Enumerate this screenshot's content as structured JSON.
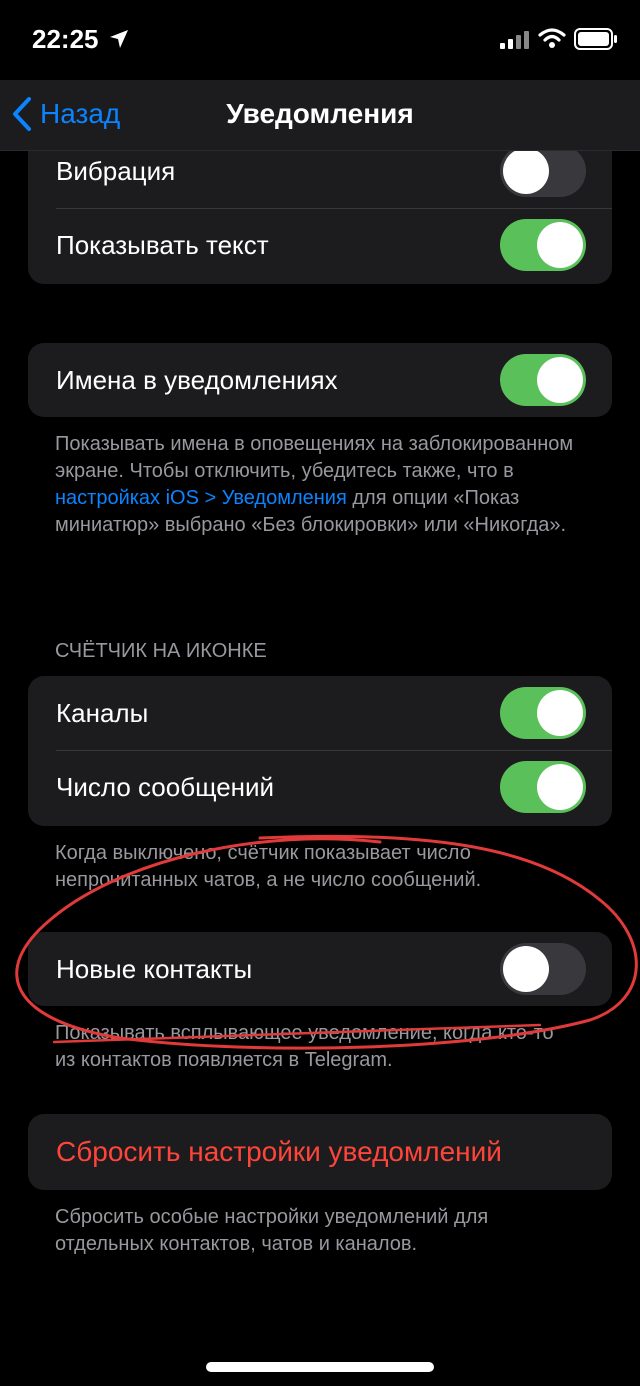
{
  "status_bar": {
    "time": "22:25"
  },
  "nav": {
    "back_label": "Назад",
    "title": "Уведомления"
  },
  "group_display": {
    "rows": [
      {
        "label": "Вибрация",
        "on": false
      },
      {
        "label": "Показывать текст",
        "on": true
      }
    ]
  },
  "group_names": {
    "row": {
      "label": "Имена в уведомлениях",
      "on": true
    },
    "note_before": "Показывать имена в оповещениях на заблокированном экране. Чтобы отключить, убедитесь также, что в ",
    "note_link": "настройках iOS > Уведомления",
    "note_after": " для опции «Показ миниатюр» выбрано «Без блокировки» или «Никогда»."
  },
  "badge_section": {
    "header": "СЧЁТЧИК НА ИКОНКЕ",
    "rows": [
      {
        "label": "Каналы",
        "on": true
      },
      {
        "label": "Число сообщений",
        "on": true
      }
    ],
    "note": "Когда выключено, счётчик показывает число непрочитанных чатов, а не число сообщений."
  },
  "new_contacts": {
    "row": {
      "label": "Новые контакты",
      "on": false
    },
    "note": "Показывать всплывающее уведомление, когда кто-то из контактов появляется в Telegram."
  },
  "reset": {
    "label": "Сбросить настройки уведомлений",
    "note": "Сбросить особые настройки уведомлений для отдельных контактов, чатов и каналов."
  },
  "colors": {
    "accent": "#0a84ff",
    "toggle_on": "#5ac05a",
    "destructive": "#ff453a",
    "annotation": "#e03a3a"
  }
}
